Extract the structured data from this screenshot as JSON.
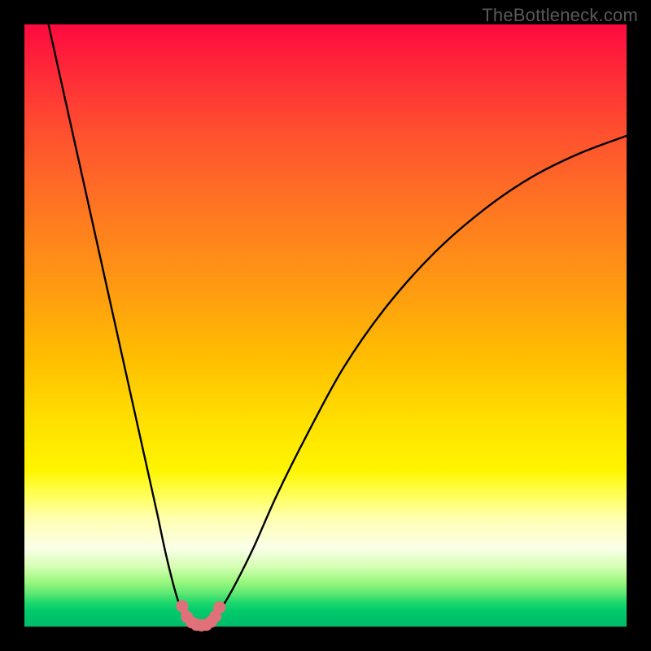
{
  "watermark": {
    "text": "TheBottleneck.com"
  },
  "chart_data": {
    "type": "line",
    "title": "",
    "xlabel": "",
    "ylabel": "",
    "xlim": [
      0,
      100
    ],
    "ylim": [
      0,
      100
    ],
    "grid": false,
    "legend": false,
    "series": [
      {
        "name": "left-branch",
        "color": "#000000",
        "x": [
          4,
          6,
          8,
          10,
          12,
          14,
          16,
          18,
          20,
          22,
          23.5,
          25,
          26,
          27,
          27.8
        ],
        "values": [
          100,
          91,
          82,
          73,
          64,
          55,
          46,
          37,
          28,
          19,
          12,
          6,
          3,
          1.2,
          0.5
        ]
      },
      {
        "name": "right-branch",
        "color": "#000000",
        "x": [
          30.5,
          31.5,
          33,
          35,
          38,
          42,
          47,
          53,
          60,
          68,
          76,
          84,
          92,
          100
        ],
        "values": [
          0.5,
          1.4,
          3.5,
          7,
          13,
          22,
          32,
          43,
          53,
          62,
          69,
          74.5,
          78.5,
          81.5
        ]
      },
      {
        "name": "valley-marker",
        "color": "#e07079",
        "marker": "circle",
        "x": [
          26.2,
          27.0,
          27.8,
          28.6,
          29.4,
          30.2,
          31.0,
          31.7,
          32.4
        ],
        "values": [
          3.4,
          1.6,
          0.7,
          0.3,
          0.2,
          0.3,
          0.8,
          1.7,
          3.2
        ]
      }
    ],
    "annotations": []
  }
}
